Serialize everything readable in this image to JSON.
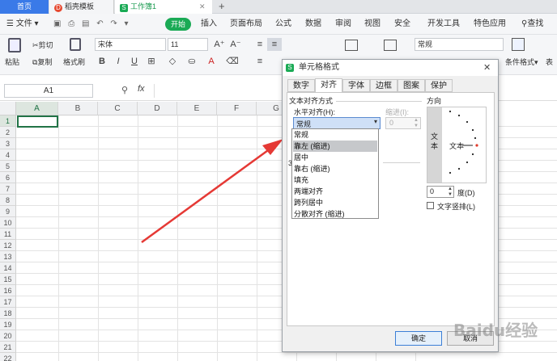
{
  "tabs": {
    "home": "首页",
    "template": "稻壳模板",
    "workbook": "工作簿1",
    "new_tab": "+"
  },
  "menu": {
    "file": "文件",
    "start": "开始",
    "insert": "插入",
    "layout": "页面布局",
    "formula": "公式",
    "data": "数据",
    "review": "审阅",
    "view": "视图",
    "security": "安全",
    "devtools": "开发工具",
    "features": "特色应用",
    "search": "查找"
  },
  "ribbon": {
    "cut": "剪切",
    "paste": "粘贴",
    "copy": "复制",
    "format_painter": "格式刷",
    "font": "宋体",
    "font_size": "11",
    "bold": "B",
    "italic": "I",
    "underline": "U",
    "number_format": "常规",
    "conditional_format": "条件格式",
    "table_style": "表"
  },
  "formula_bar": {
    "cell_ref": "A1",
    "fx": "fx"
  },
  "columns": [
    "A",
    "B",
    "C",
    "D",
    "E",
    "F",
    "G",
    "H",
    "M",
    "N",
    "O"
  ],
  "rows": [
    "1",
    "2",
    "3",
    "4",
    "5",
    "6",
    "7",
    "8",
    "9",
    "10",
    "11",
    "12",
    "13",
    "14",
    "15",
    "16",
    "17",
    "18",
    "19",
    "20",
    "21",
    "22"
  ],
  "dialog": {
    "title": "单元格格式",
    "tabs": [
      "数字",
      "对齐",
      "字体",
      "边框",
      "图案",
      "保护"
    ],
    "text_align_section": "文本对齐方式",
    "horizontal_label": "水平对齐(H):",
    "horizontal_value": "常规",
    "indent_label": "缩进(I):",
    "indent_value": "0",
    "direction_label": "方向",
    "vertical_text": "文本",
    "orientation_text": "文本",
    "degrees_value": "0",
    "degrees_label": "度(D)",
    "vertical_stack_label": "文字竖排(L)",
    "ok": "确定",
    "cancel": "取消",
    "partial_label": "3"
  },
  "dropdown_options": [
    "常规",
    "靠左 (缩进)",
    "居中",
    "靠右 (缩进)",
    "填充",
    "两端对齐",
    "跨列居中",
    "分散对齐 (缩进)"
  ],
  "watermark": "Baidu经验"
}
